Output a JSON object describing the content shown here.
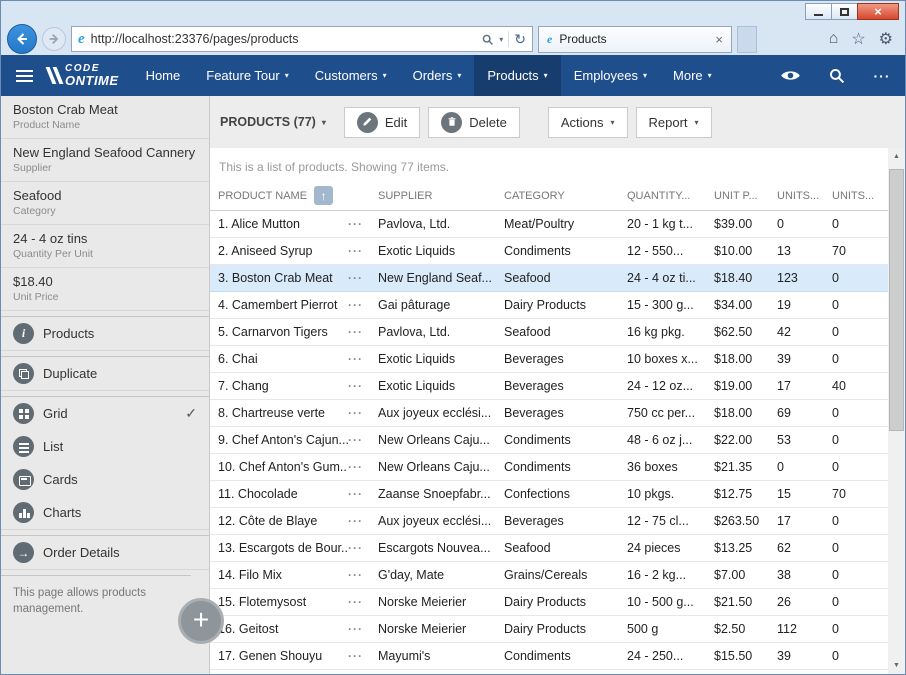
{
  "browser": {
    "url": "http://localhost:23376/pages/products",
    "tab": {
      "title": "Products"
    }
  },
  "navbar": {
    "logo_top": "CODE",
    "logo_bottom": "ONTIME",
    "items": [
      {
        "label": "Home",
        "dropdown": false,
        "active": false
      },
      {
        "label": "Feature Tour",
        "dropdown": true,
        "active": false
      },
      {
        "label": "Customers",
        "dropdown": true,
        "active": false
      },
      {
        "label": "Orders",
        "dropdown": true,
        "active": false
      },
      {
        "label": "Products",
        "dropdown": true,
        "active": true
      },
      {
        "label": "Employees",
        "dropdown": true,
        "active": false
      },
      {
        "label": "More",
        "dropdown": true,
        "active": false
      }
    ]
  },
  "sidebar": {
    "summary": [
      {
        "value": "Boston Crab Meat",
        "label": "Product Name"
      },
      {
        "value": "New England Seafood Cannery",
        "label": "Supplier"
      },
      {
        "value": "Seafood",
        "label": "Category"
      },
      {
        "value": "24 - 4 oz tins",
        "label": "Quantity Per Unit"
      },
      {
        "value": "$18.40",
        "label": "Unit Price"
      }
    ],
    "products_link": "Products",
    "duplicate_link": "Duplicate",
    "views": [
      {
        "label": "Grid",
        "icon": "grid",
        "selected": true
      },
      {
        "label": "List",
        "icon": "list",
        "selected": false
      },
      {
        "label": "Cards",
        "icon": "cards",
        "selected": false
      },
      {
        "label": "Charts",
        "icon": "charts",
        "selected": false
      }
    ],
    "order_details_link": "Order Details",
    "description": "This page allows products management."
  },
  "toolbar": {
    "title": "PRODUCTS (77)",
    "edit_label": "Edit",
    "delete_label": "Delete",
    "actions_label": "Actions",
    "report_label": "Report"
  },
  "list": {
    "status": "This is a list of products. Showing 77 items.",
    "columns": [
      "PRODUCT NAME",
      "SUPPLIER",
      "CATEGORY",
      "QUANTITY...",
      "UNIT P...",
      "UNITS...",
      "UNITS..."
    ],
    "rows": [
      {
        "name": "1. Alice Mutton",
        "supplier": "Pavlova, Ltd.",
        "category": "Meat/Poultry",
        "quantity": "20 - 1 kg t...",
        "unit_price": "$39.00",
        "units_in_stock": "0",
        "units_on_order": "0",
        "selected": false
      },
      {
        "name": "2. Aniseed Syrup",
        "supplier": "Exotic Liquids",
        "category": "Condiments",
        "quantity": "12 - 550...",
        "unit_price": "$10.00",
        "units_in_stock": "13",
        "units_on_order": "70",
        "selected": false
      },
      {
        "name": "3. Boston Crab Meat",
        "supplier": "New England Seaf...",
        "category": "Seafood",
        "quantity": "24 - 4 oz ti...",
        "unit_price": "$18.40",
        "units_in_stock": "123",
        "units_on_order": "0",
        "selected": true
      },
      {
        "name": "4. Camembert Pierrot",
        "supplier": "Gai pâturage",
        "category": "Dairy Products",
        "quantity": "15 - 300 g...",
        "unit_price": "$34.00",
        "units_in_stock": "19",
        "units_on_order": "0",
        "selected": false
      },
      {
        "name": "5. Carnarvon Tigers",
        "supplier": "Pavlova, Ltd.",
        "category": "Seafood",
        "quantity": "16 kg pkg.",
        "unit_price": "$62.50",
        "units_in_stock": "42",
        "units_on_order": "0",
        "selected": false
      },
      {
        "name": "6. Chai",
        "supplier": "Exotic Liquids",
        "category": "Beverages",
        "quantity": "10 boxes x...",
        "unit_price": "$18.00",
        "units_in_stock": "39",
        "units_on_order": "0",
        "selected": false
      },
      {
        "name": "7. Chang",
        "supplier": "Exotic Liquids",
        "category": "Beverages",
        "quantity": "24 - 12 oz...",
        "unit_price": "$19.00",
        "units_in_stock": "17",
        "units_on_order": "40",
        "selected": false
      },
      {
        "name": "8. Chartreuse verte",
        "supplier": "Aux joyeux ecclési...",
        "category": "Beverages",
        "quantity": "750 cc per...",
        "unit_price": "$18.00",
        "units_in_stock": "69",
        "units_on_order": "0",
        "selected": false
      },
      {
        "name": "9. Chef Anton's Cajun...",
        "supplier": "New Orleans Caju...",
        "category": "Condiments",
        "quantity": "48 - 6 oz j...",
        "unit_price": "$22.00",
        "units_in_stock": "53",
        "units_on_order": "0",
        "selected": false
      },
      {
        "name": "10. Chef Anton's Gum...",
        "supplier": "New Orleans Caju...",
        "category": "Condiments",
        "quantity": "36 boxes",
        "unit_price": "$21.35",
        "units_in_stock": "0",
        "units_on_order": "0",
        "selected": false
      },
      {
        "name": "11. Chocolade",
        "supplier": "Zaanse Snoepfabr...",
        "category": "Confections",
        "quantity": "10 pkgs.",
        "unit_price": "$12.75",
        "units_in_stock": "15",
        "units_on_order": "70",
        "selected": false
      },
      {
        "name": "12. Côte de Blaye",
        "supplier": "Aux joyeux ecclési...",
        "category": "Beverages",
        "quantity": "12 - 75 cl...",
        "unit_price": "$263.50",
        "units_in_stock": "17",
        "units_on_order": "0",
        "selected": false
      },
      {
        "name": "13. Escargots de Bour...",
        "supplier": "Escargots Nouvea...",
        "category": "Seafood",
        "quantity": "24 pieces",
        "unit_price": "$13.25",
        "units_in_stock": "62",
        "units_on_order": "0",
        "selected": false
      },
      {
        "name": "14. Filo Mix",
        "supplier": "G'day, Mate",
        "category": "Grains/Cereals",
        "quantity": "16 - 2 kg...",
        "unit_price": "$7.00",
        "units_in_stock": "38",
        "units_on_order": "0",
        "selected": false
      },
      {
        "name": "15. Flotemysost",
        "supplier": "Norske Meierier",
        "category": "Dairy Products",
        "quantity": "10 - 500 g...",
        "unit_price": "$21.50",
        "units_in_stock": "26",
        "units_on_order": "0",
        "selected": false
      },
      {
        "name": "16. Geitost",
        "supplier": "Norske Meierier",
        "category": "Dairy Products",
        "quantity": "500 g",
        "unit_price": "$2.50",
        "units_in_stock": "112",
        "units_on_order": "0",
        "selected": false
      },
      {
        "name": "17. Genen Shouyu",
        "supplier": "Mayumi's",
        "category": "Condiments",
        "quantity": "24 - 250...",
        "unit_price": "$15.50",
        "units_in_stock": "39",
        "units_on_order": "0",
        "selected": false
      }
    ]
  },
  "icons": {
    "caret": "▾",
    "check": "✓",
    "close": "×",
    "ellipsis": "···",
    "home": "⌂",
    "star": "☆",
    "gear": "⚙",
    "refresh": "↻",
    "sort_up": "↑",
    "info": "i",
    "arrow": "→",
    "scroll_up": "▲",
    "scroll_down": "▼",
    "ie": "e",
    "plus": "+"
  },
  "colors": {
    "navbar": "#1f4e8c",
    "navbar_active": "#173c6e",
    "selected_row": "#d9eafa",
    "chrome": "#d8e5f3",
    "sidebar": "#e9e9e9",
    "toolbar": "#ededed",
    "close_red": "#d6492f",
    "back_blue": "#2479c8"
  }
}
